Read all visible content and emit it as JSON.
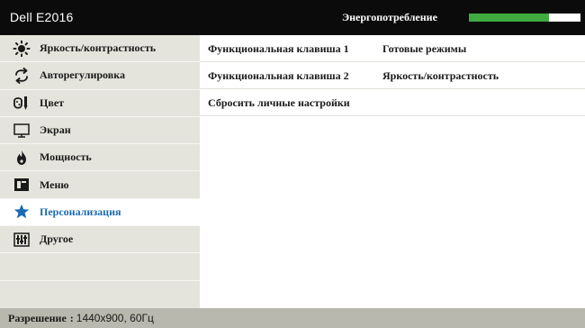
{
  "titlebar": {
    "model": "Dell E2016",
    "energy_label": "Энергопотребление",
    "energy_level": 0.72
  },
  "sidebar": {
    "items": [
      {
        "label": "Яркость/контрастность",
        "icon": "brightness-icon"
      },
      {
        "label": "Авторегулировка",
        "icon": "auto-adjust-icon"
      },
      {
        "label": "Цвет",
        "icon": "color-icon"
      },
      {
        "label": "Экран",
        "icon": "display-icon"
      },
      {
        "label": "Мощность",
        "icon": "power-icon"
      },
      {
        "label": "Меню",
        "icon": "menu-icon"
      },
      {
        "label": "Персонализация",
        "icon": "star-icon",
        "active": true
      },
      {
        "label": "Другое",
        "icon": "other-icon"
      }
    ]
  },
  "content": {
    "rows": [
      {
        "label": "Функциональная клавиша 1",
        "value": "Готовые режимы"
      },
      {
        "label": "Функциональная клавиша 2",
        "value": "Яркость/контрастность"
      },
      {
        "label": "Сбросить личные настройки",
        "value": ""
      }
    ]
  },
  "status": {
    "label": "Разрешение",
    "separator": ":",
    "value": "1440x900, 60Гц"
  },
  "colors": {
    "titlebar_bg": "#0b0b0b",
    "meter_fill": "#3faa3f",
    "sidebar_bg": "#e4e4dc",
    "active_text": "#1a6ab0",
    "statusbar_bg": "#b8b8ae"
  }
}
